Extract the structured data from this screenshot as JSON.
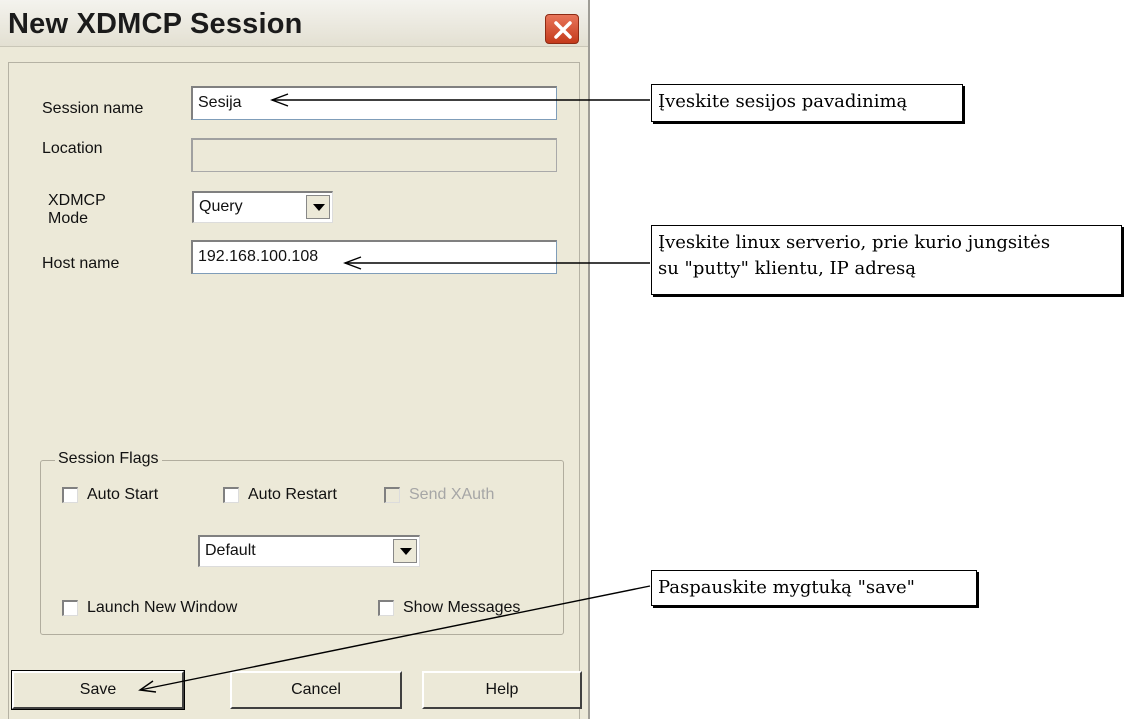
{
  "dialog": {
    "title": "New XDMCP Session",
    "fields": {
      "session_name_label": "Session name",
      "session_name_value": "Sesija",
      "location_label": "Location",
      "location_value": "",
      "mode_label_line1": "XDMCP",
      "mode_label_line2": "Mode",
      "mode_value": "Query",
      "host_label": "Host name",
      "host_value": "192.168.100.108"
    },
    "flags": {
      "title": "Session Flags",
      "auto_start": "Auto Start",
      "auto_restart": "Auto Restart",
      "send_xauth": "Send XAuth",
      "dropdown_value": "Default",
      "launch_new_window": "Launch New Window",
      "show_messages": "Show Messages"
    },
    "buttons": {
      "save": "Save",
      "cancel": "Cancel",
      "help": "Help"
    }
  },
  "annotations": {
    "session_name": "Įveskite sesijos pavadinimą",
    "host_line1": "Įveskite linux serverio, prie kurio jungsitės",
    "host_line2": "su \"putty\" klientu,  IP adresą",
    "save": "Paspauskite mygtuką \"save\""
  }
}
